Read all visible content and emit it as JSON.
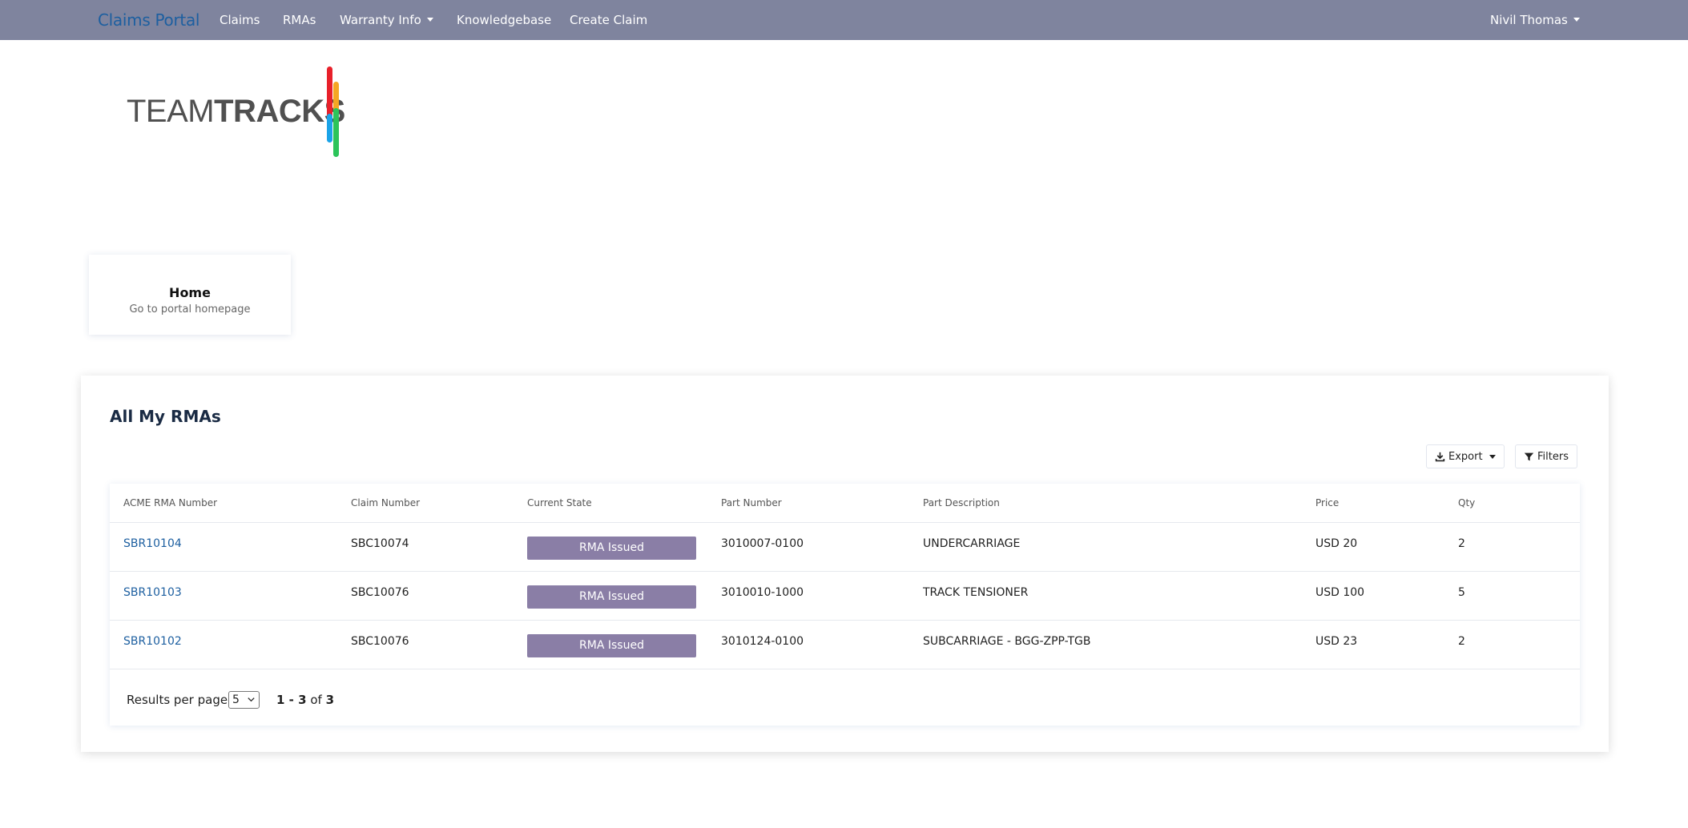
{
  "navbar": {
    "brand": "Claims Portal",
    "links": [
      "Claims",
      "RMAs",
      "Warranty Info",
      "Knowledgebase",
      "Create Claim"
    ],
    "user": "Nivil Thomas"
  },
  "logo": {
    "text_light": "TEAM",
    "text_bold": "TRACKS",
    "colors": [
      "#e8202a",
      "#f5a623",
      "#1aa3e8",
      "#2cc45a"
    ]
  },
  "home_card": {
    "title": "Home",
    "subtitle": "Go to portal homepage"
  },
  "panel": {
    "title": "All My RMAs",
    "export_label": "Export",
    "filters_label": "Filters",
    "columns": [
      "ACME RMA Number",
      "Claim Number",
      "Current State",
      "Part Number",
      "Part Description",
      "Price",
      "Qty"
    ],
    "rows": [
      {
        "rma": "SBR10104",
        "claim": "SBC10074",
        "state": "RMA Issued",
        "part": "3010007-0100",
        "desc": "UNDERCARRIAGE",
        "price": "USD 20",
        "qty": "2"
      },
      {
        "rma": "SBR10103",
        "claim": "SBC10076",
        "state": "RMA Issued",
        "part": "3010010-1000",
        "desc": "TRACK TENSIONER",
        "price": "USD 100",
        "qty": "5"
      },
      {
        "rma": "SBR10102",
        "claim": "SBC10076",
        "state": "RMA Issued",
        "part": "3010124-0100",
        "desc": "SUBCARRIAGE - BGG-ZPP-TGB",
        "price": "USD 23",
        "qty": "2"
      }
    ],
    "pagination": {
      "label": "Results per page",
      "per_page": "5",
      "range": "1 - 3",
      "of": "of",
      "total": "3"
    }
  },
  "colors": {
    "navbar": "#7f849e",
    "brand": "#1d5fa0",
    "badge": "#8a7ea6"
  }
}
